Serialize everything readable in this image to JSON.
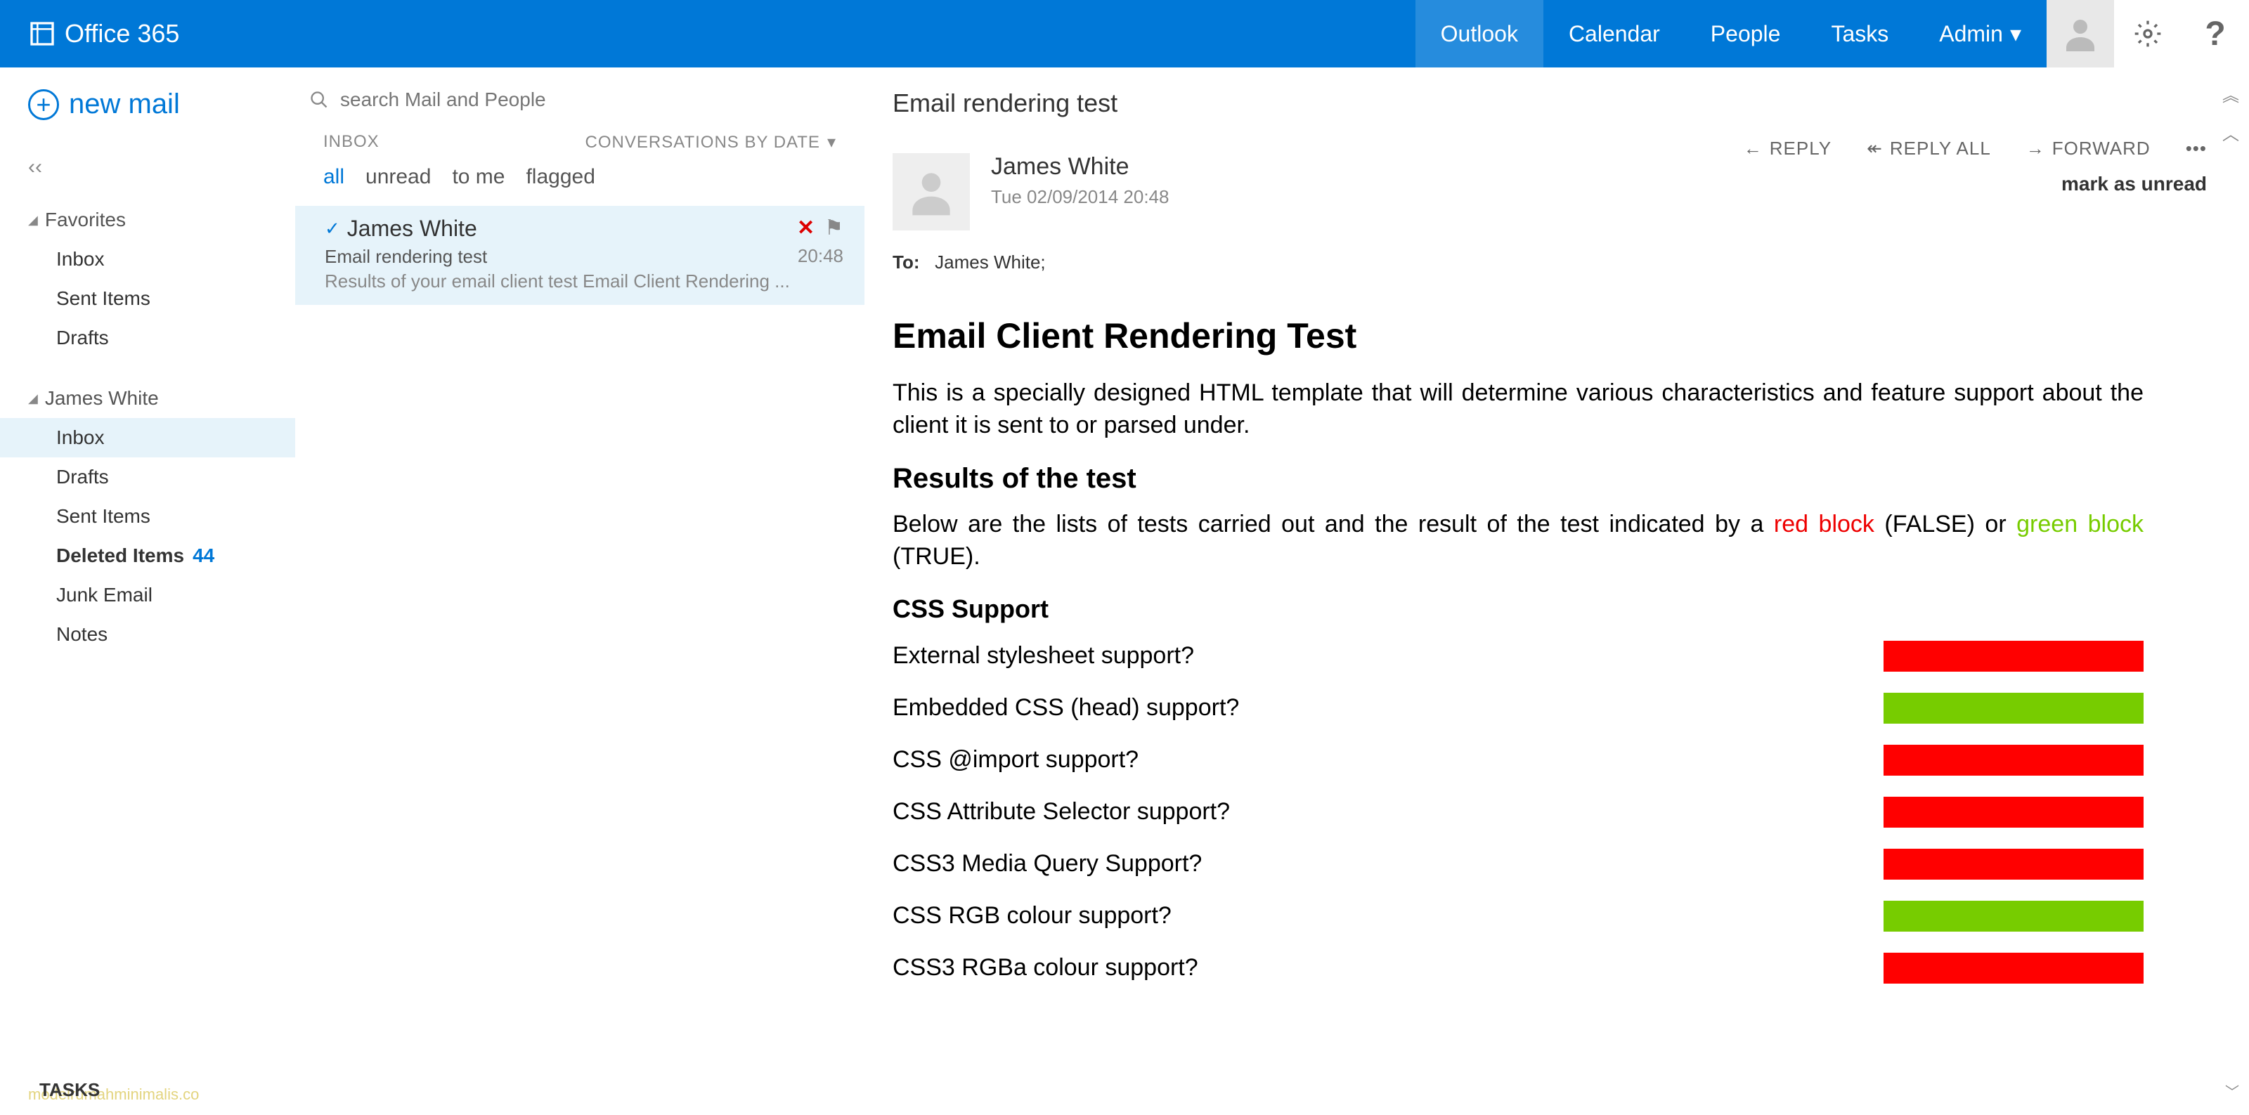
{
  "header": {
    "brand": "Office 365",
    "nav": [
      "Outlook",
      "Calendar",
      "People",
      "Tasks",
      "Admin"
    ],
    "active_nav": 0
  },
  "left": {
    "new_mail": "new mail",
    "groups": [
      {
        "name": "Favorites",
        "items": [
          {
            "label": "Inbox"
          },
          {
            "label": "Sent Items"
          },
          {
            "label": "Drafts"
          }
        ]
      },
      {
        "name": "James White",
        "items": [
          {
            "label": "Inbox",
            "selected": true
          },
          {
            "label": "Drafts"
          },
          {
            "label": "Sent Items"
          },
          {
            "label": "Deleted Items",
            "bold": true,
            "count": "44"
          },
          {
            "label": "Junk Email"
          },
          {
            "label": "Notes"
          }
        ]
      }
    ],
    "tasks": "TASKS",
    "watermark": "modelrumahminimalis.co"
  },
  "mid": {
    "search_placeholder": "search Mail and People",
    "inbox_label": "INBOX",
    "sort_label": "CONVERSATIONS BY DATE",
    "filters": [
      "all",
      "unread",
      "to me",
      "flagged"
    ],
    "message": {
      "sender": "James White",
      "subject": "Email rendering test",
      "preview": "Results of your email client test Email Client Rendering ...",
      "time": "20:48"
    }
  },
  "read": {
    "subject": "Email rendering test",
    "sender": "James White",
    "date": "Tue 02/09/2014 20:48",
    "to_label": "To:",
    "to": "James White;",
    "actions": {
      "reply": "REPLY",
      "reply_all": "REPLY ALL",
      "forward": "FORWARD"
    },
    "mark_unread": "mark as unread",
    "body": {
      "h1": "Email Client Rendering Test",
      "p1": "This is a specially designed HTML template that will determine various characteristics and feature support about the client it is sent to or parsed under.",
      "h2": "Results of the test",
      "p2a": "Below are the lists of tests carried out and the result of the test indicated by a ",
      "red": "red block",
      "p2b": " (FALSE) or ",
      "green": "green block",
      "p2c": " (TRUE).",
      "h3": "CSS Support",
      "tests": [
        {
          "label": "External stylesheet support?",
          "result": false
        },
        {
          "label": "Embedded CSS (head) support?",
          "result": true
        },
        {
          "label": "CSS @import support?",
          "result": false
        },
        {
          "label": "CSS Attribute Selector support?",
          "result": false
        },
        {
          "label": "CSS3 Media Query Support?",
          "result": false
        },
        {
          "label": "CSS RGB colour support?",
          "result": true
        },
        {
          "label": "CSS3 RGBa colour support?",
          "result": false
        }
      ]
    }
  }
}
